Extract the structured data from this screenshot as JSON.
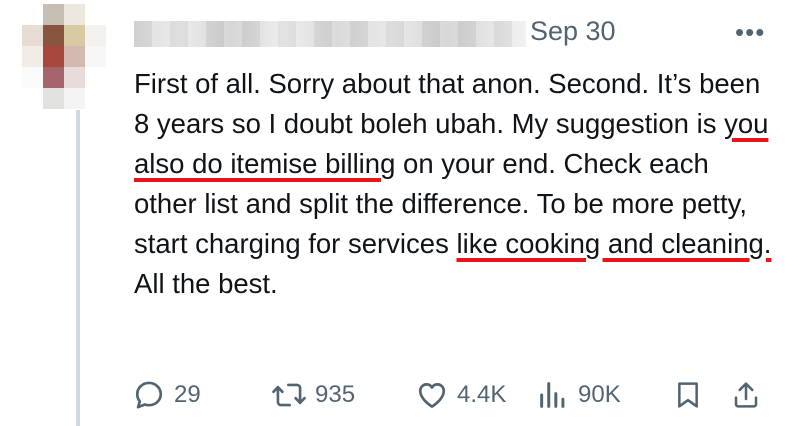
{
  "tweet": {
    "date": "Sep 30",
    "more_label": "•••",
    "text_parts": {
      "p1": "First of all. Sorry about that anon. Second. It’s been 8 years so I doubt boleh ubah. My suggestion is ",
      "h1": "you also do itemise billing",
      "p2": " on your end. Check each other list and split the difference. To be more petty, start charging for services ",
      "h2": "like cooking and cleaning.",
      "p3": " All the best."
    },
    "highlight_color": "#e8141a"
  },
  "actions": {
    "replies": {
      "icon": "reply-icon",
      "count": "29"
    },
    "retweets": {
      "icon": "retweet-icon",
      "count": "935"
    },
    "likes": {
      "icon": "heart-icon",
      "count": "4.4K"
    },
    "views": {
      "icon": "views-icon",
      "count": "90K"
    },
    "bookmark": {
      "icon": "bookmark-icon"
    },
    "share": {
      "icon": "share-icon"
    }
  },
  "colors": {
    "text": "#0f1419",
    "muted": "#536471",
    "thread_line": "#cfd9de"
  }
}
